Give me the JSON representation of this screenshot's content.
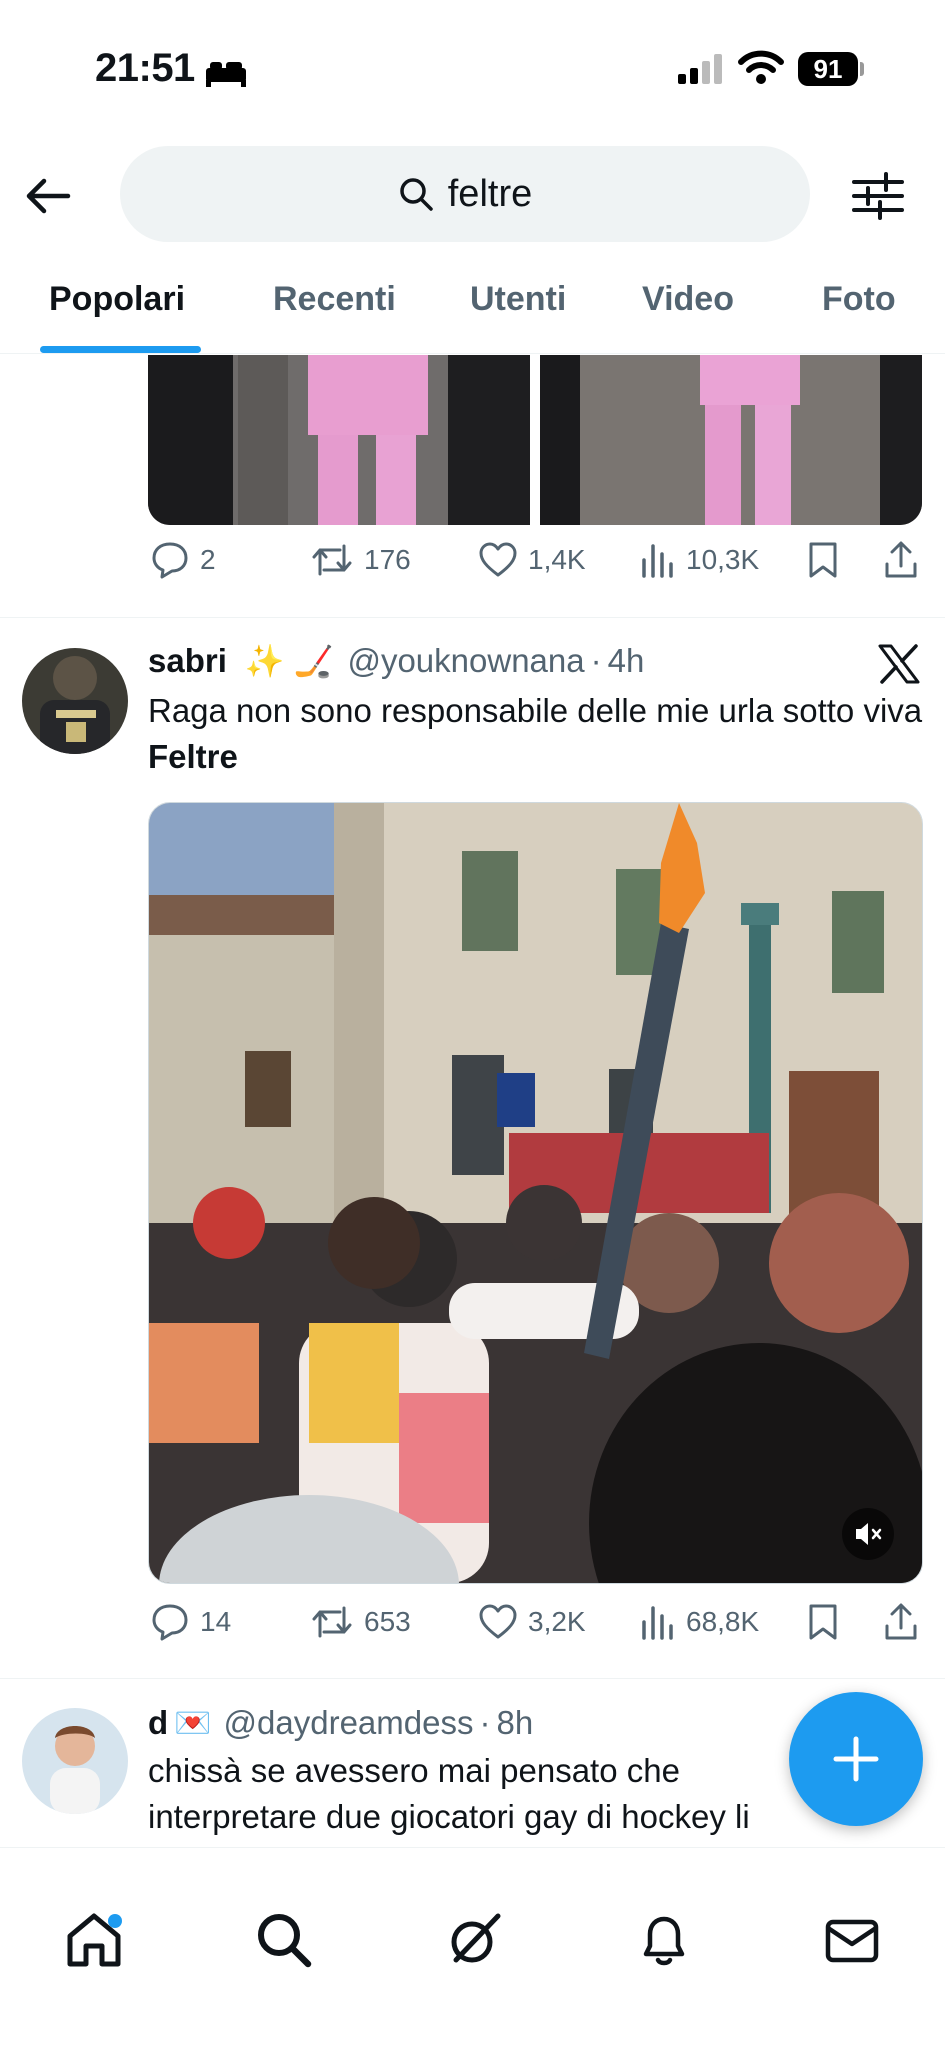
{
  "status_bar": {
    "time": "21:51",
    "battery": "91"
  },
  "search": {
    "query": "feltre"
  },
  "tabs": [
    {
      "label": "Popolari",
      "active": true
    },
    {
      "label": "Recenti"
    },
    {
      "label": "Utenti"
    },
    {
      "label": "Video"
    },
    {
      "label": "Foto"
    }
  ],
  "tweet_prev": {
    "stats": {
      "replies": "2",
      "reposts": "176",
      "likes": "1,4K",
      "views": "10,3K"
    }
  },
  "tweet_1": {
    "name": "sabri",
    "emoji": "✨ 🏒",
    "handle": "@youknownana",
    "sep": "·",
    "time": "4h",
    "text_prefix": "Raga non sono responsabile delle mie urla sotto viva ",
    "text_bold": "Feltre",
    "stats": {
      "replies": "14",
      "reposts": "653",
      "likes": "3,2K",
      "views": "68,8K"
    }
  },
  "tweet_2": {
    "name": "d",
    "emoji": "💌",
    "handle": "@daydreamdess",
    "sep": "·",
    "time": "8h",
    "text": "chissà se avessero mai pensato che interpretare due giocatori gay di hockey li"
  },
  "colors": {
    "accent": "#1d9bf0",
    "muted": "#536471",
    "text": "#0f1419"
  }
}
